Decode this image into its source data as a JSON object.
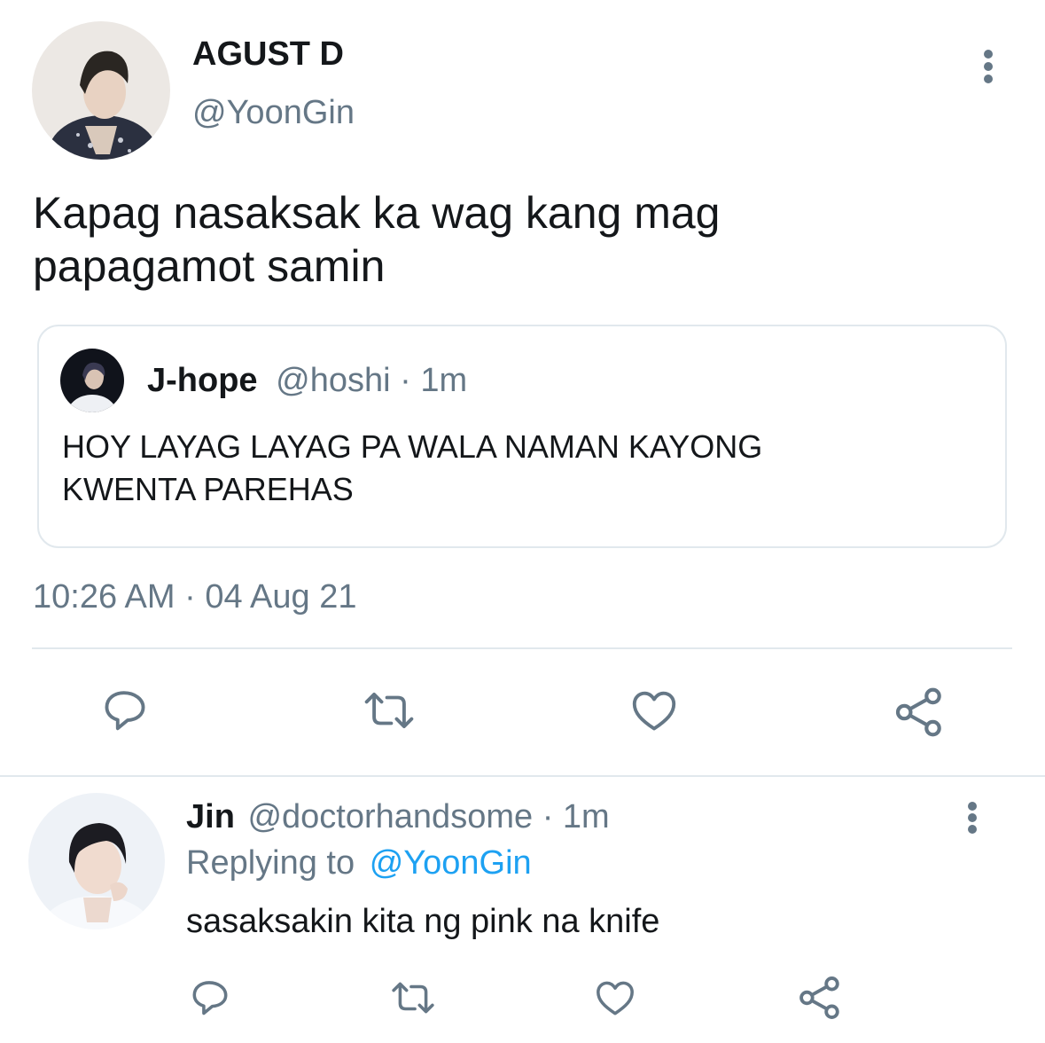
{
  "tweet": {
    "author_name": "AGUST D",
    "author_handle": "@YoonGin",
    "text_line1": "Kapag nasaksak ka wag kang mag",
    "text_line2": "papagamot samin",
    "timestamp": "10:26 AM · 04 Aug 21"
  },
  "quote": {
    "author_name": "J-hope",
    "author_handle": "@hoshi",
    "time": "· 1m",
    "text_line1": "HOY LAYAG LAYAG PA WALA NAMAN KAYONG",
    "text_line2": "KWENTA PAREHAS"
  },
  "reply": {
    "author_name": "Jin",
    "author_handle": "@doctorhandsome",
    "time": "· 1m",
    "replying_prefix": "Replying to",
    "replying_handle": "@YoonGin",
    "text": "sasaksakin kita ng pink na knife"
  },
  "actions": [
    "reply-icon",
    "retweet-icon",
    "like-icon",
    "share-icon"
  ],
  "colors": {
    "accent": "#1da1f2",
    "muted": "#657786",
    "divider": "#e1e8ed"
  }
}
